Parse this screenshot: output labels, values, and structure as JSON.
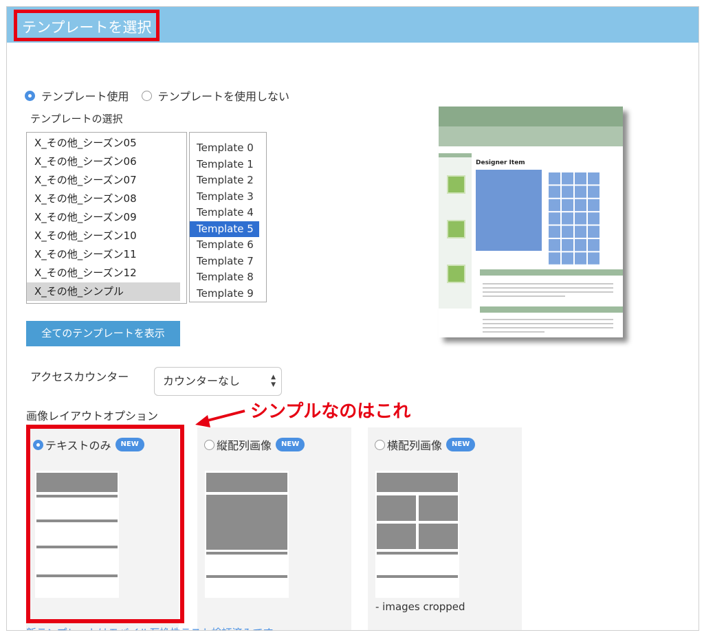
{
  "header": {
    "title": "テンプレートを選択",
    "bg_color": "#87c4e8",
    "highlight_color": "#e60012"
  },
  "template_use": {
    "options": [
      {
        "label": "テンプレート使用",
        "checked": true
      },
      {
        "label": "テンプレートを使用しない",
        "checked": false
      }
    ]
  },
  "template_select": {
    "label": "テンプレートの選択",
    "categories": [
      "X_その他_シーズン05",
      "X_その他_シーズン06",
      "X_その他_シーズン07",
      "X_その他_シーズン08",
      "X_その他_シーズン09",
      "X_その他_シーズン10",
      "X_その他_シーズン11",
      "X_その他_シーズン12",
      "X_その他_シンプル"
    ],
    "selected_category": "X_その他_シンプル",
    "templates": [
      "Template 0",
      "Template 1",
      "Template 2",
      "Template 3",
      "Template 4",
      "Template 5",
      "Template 6",
      "Template 7",
      "Template 8",
      "Template 9"
    ],
    "selected_template": "Template 5"
  },
  "show_all_button": {
    "label": "全てのテンプレートを表示",
    "color": "#4a9dd4"
  },
  "preview": {
    "heading": "Designer Item"
  },
  "access_counter": {
    "label": "アクセスカウンター",
    "value": "カウンターなし"
  },
  "image_layout": {
    "label": "画像レイアウトオプション",
    "annotation": "シンプルなのはこれ",
    "badge": "NEW",
    "options": [
      {
        "label": "テキストのみ",
        "checked": true
      },
      {
        "label": "縦配列画像",
        "checked": false
      },
      {
        "label": "横配列画像",
        "checked": false,
        "note": "- images cropped"
      }
    ]
  },
  "footer_note": "新テンプレートはモバイル互換性テスト検証済みです"
}
